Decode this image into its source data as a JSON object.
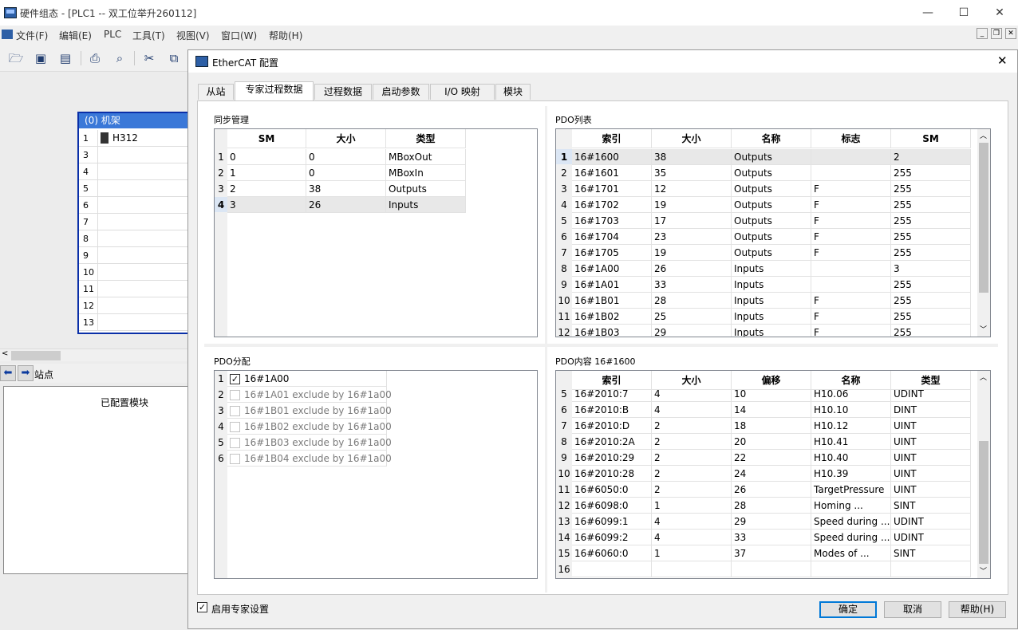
{
  "app": {
    "title": "硬件组态 - [PLC1 -- 双工位举升260112]",
    "menu": [
      "文件(F)",
      "编辑(E)",
      "PLC",
      "工具(T)",
      "视图(V)",
      "窗口(W)",
      "帮助(H)"
    ],
    "window_buttons": [
      "—",
      "☐",
      "✕"
    ]
  },
  "rack": {
    "title": "(0) 机架",
    "rows": [
      "1",
      "3",
      "4",
      "5",
      "6",
      "7",
      "8",
      "9",
      "10",
      "11",
      "12",
      "13"
    ],
    "module": "H312"
  },
  "station_label": "站点",
  "configured_modules": "已配置模块",
  "dialog": {
    "title": "EtherCAT 配置",
    "tabs": [
      "从站",
      "专家过程数据",
      "过程数据",
      "启动参数",
      "I/O 映射",
      "模块"
    ],
    "active_tab": 1,
    "expert_checkbox": "启用专家设置",
    "buttons": {
      "ok": "确定",
      "cancel": "取消",
      "help": "帮助(H)"
    }
  },
  "sync_manager": {
    "label": "同步管理",
    "columns": [
      "SM",
      "大小",
      "类型"
    ],
    "rows": [
      [
        "1",
        "0",
        "0",
        "MBoxOut"
      ],
      [
        "2",
        "1",
        "0",
        "MBoxIn"
      ],
      [
        "3",
        "2",
        "38",
        "Outputs"
      ],
      [
        "4",
        "3",
        "26",
        "Inputs"
      ]
    ],
    "selected": 3
  },
  "pdo_list": {
    "label": "PDO列表",
    "columns": [
      "索引",
      "大小",
      "名称",
      "标志",
      "SM"
    ],
    "rows": [
      [
        "1",
        "16#1600",
        "38",
        "Outputs",
        "",
        "2"
      ],
      [
        "2",
        "16#1601",
        "35",
        "Outputs",
        "",
        "255"
      ],
      [
        "3",
        "16#1701",
        "12",
        "Outputs",
        "F",
        "255"
      ],
      [
        "4",
        "16#1702",
        "19",
        "Outputs",
        "F",
        "255"
      ],
      [
        "5",
        "16#1703",
        "17",
        "Outputs",
        "F",
        "255"
      ],
      [
        "6",
        "16#1704",
        "23",
        "Outputs",
        "F",
        "255"
      ],
      [
        "7",
        "16#1705",
        "19",
        "Outputs",
        "F",
        "255"
      ],
      [
        "8",
        "16#1A00",
        "26",
        "Inputs",
        "",
        "3"
      ],
      [
        "9",
        "16#1A01",
        "33",
        "Inputs",
        "",
        "255"
      ],
      [
        "10",
        "16#1B01",
        "28",
        "Inputs",
        "F",
        "255"
      ],
      [
        "11",
        "16#1B02",
        "25",
        "Inputs",
        "F",
        "255"
      ],
      [
        "12",
        "16#1B03",
        "29",
        "Inputs",
        "F",
        "255"
      ]
    ],
    "selected": 0
  },
  "pdo_assign": {
    "label": "PDO分配",
    "rows": [
      {
        "n": "1",
        "text": "16#1A00",
        "checked": true,
        "disabled": false
      },
      {
        "n": "2",
        "text": "16#1A01  exclude by 16#1a00",
        "checked": false,
        "disabled": true
      },
      {
        "n": "3",
        "text": "16#1B01  exclude by 16#1a00",
        "checked": false,
        "disabled": true
      },
      {
        "n": "4",
        "text": "16#1B02  exclude by 16#1a00",
        "checked": false,
        "disabled": true
      },
      {
        "n": "5",
        "text": "16#1B03  exclude by 16#1a00",
        "checked": false,
        "disabled": true
      },
      {
        "n": "6",
        "text": "16#1B04  exclude by 16#1a00",
        "checked": false,
        "disabled": true
      }
    ]
  },
  "pdo_content": {
    "label": "PDO内容 16#1600",
    "columns": [
      "索引",
      "大小",
      "偏移",
      "名称",
      "类型"
    ],
    "rows": [
      [
        "5",
        "16#2010:7",
        "4",
        "10",
        "H10.06",
        "UDINT"
      ],
      [
        "6",
        "16#2010:B",
        "4",
        "14",
        "H10.10",
        "DINT"
      ],
      [
        "7",
        "16#2010:D",
        "2",
        "18",
        "H10.12",
        "UINT"
      ],
      [
        "8",
        "16#2010:2A",
        "2",
        "20",
        "H10.41",
        "UINT"
      ],
      [
        "9",
        "16#2010:29",
        "2",
        "22",
        "H10.40",
        "UINT"
      ],
      [
        "10",
        "16#2010:28",
        "2",
        "24",
        "H10.39",
        "UINT"
      ],
      [
        "11",
        "16#6050:0",
        "2",
        "26",
        "TargetPressure",
        "UINT"
      ],
      [
        "12",
        "16#6098:0",
        "1",
        "28",
        "Homing ...",
        "SINT"
      ],
      [
        "13",
        "16#6099:1",
        "4",
        "29",
        "Speed during ...",
        "UDINT"
      ],
      [
        "14",
        "16#6099:2",
        "4",
        "33",
        "Speed during ...",
        "UDINT"
      ],
      [
        "15",
        "16#6060:0",
        "1",
        "37",
        "Modes of ...",
        "SINT"
      ],
      [
        "16",
        "",
        "",
        "",
        "",
        ""
      ]
    ]
  }
}
